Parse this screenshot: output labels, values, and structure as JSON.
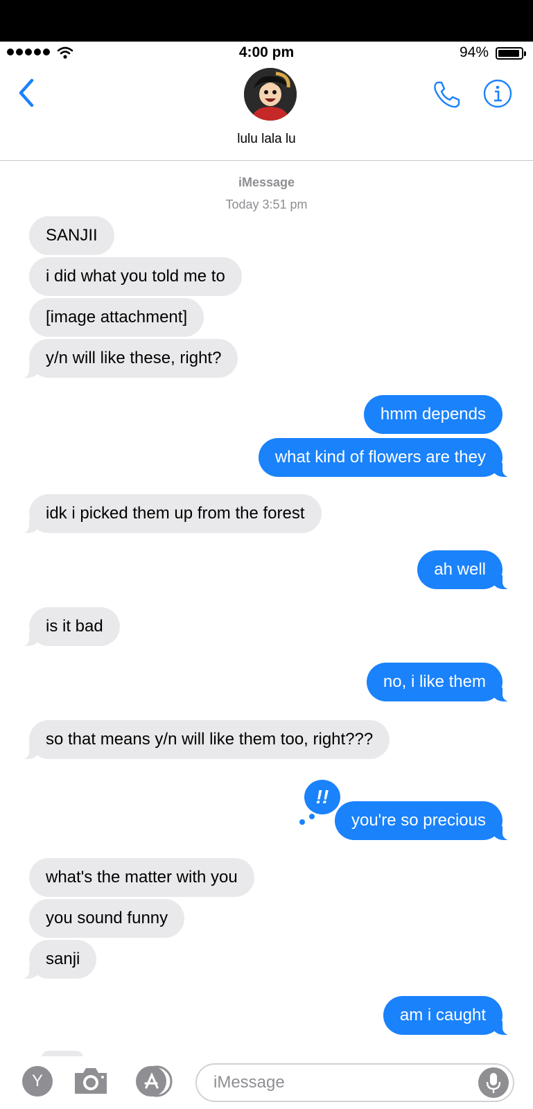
{
  "status_bar": {
    "time": "4:00 pm",
    "battery_percent": "94%",
    "battery_level": 0.94
  },
  "header": {
    "contact_name": "lulu lala lu",
    "avatar_icon": "avatar-image"
  },
  "thread_meta": {
    "service": "iMessage",
    "timestamp": "Today 3:51 pm"
  },
  "messages": [
    {
      "from": "them",
      "text": "SANJII"
    },
    {
      "from": "them",
      "text": "i did what you told me to"
    },
    {
      "from": "them",
      "text": "[image attachment]"
    },
    {
      "from": "them",
      "text": "y/n will like these, right?"
    },
    {
      "from": "me",
      "text": "hmm depends"
    },
    {
      "from": "me",
      "text": "what kind of flowers are they"
    },
    {
      "from": "them",
      "text": "idk i picked them up from the forest"
    },
    {
      "from": "me",
      "text": "ah well"
    },
    {
      "from": "them",
      "text": "is it bad"
    },
    {
      "from": "me",
      "text": "no, i like them"
    },
    {
      "from": "them",
      "text": "so that means y/n will like them too, right???"
    },
    {
      "from": "me",
      "text": "you're so precious",
      "reaction": "!!"
    },
    {
      "from": "them",
      "text": "what's the matter with you"
    },
    {
      "from": "them",
      "text": "you sound funny"
    },
    {
      "from": "them",
      "text": "sanji"
    },
    {
      "from": "me",
      "text": "am i caught"
    }
  ],
  "composer": {
    "placeholder": "iMessage",
    "app_label": "Y"
  },
  "colors": {
    "sent_bubble": "#1a82fb",
    "received_bubble": "#e9e9eb",
    "accent": "#1a82fb"
  }
}
